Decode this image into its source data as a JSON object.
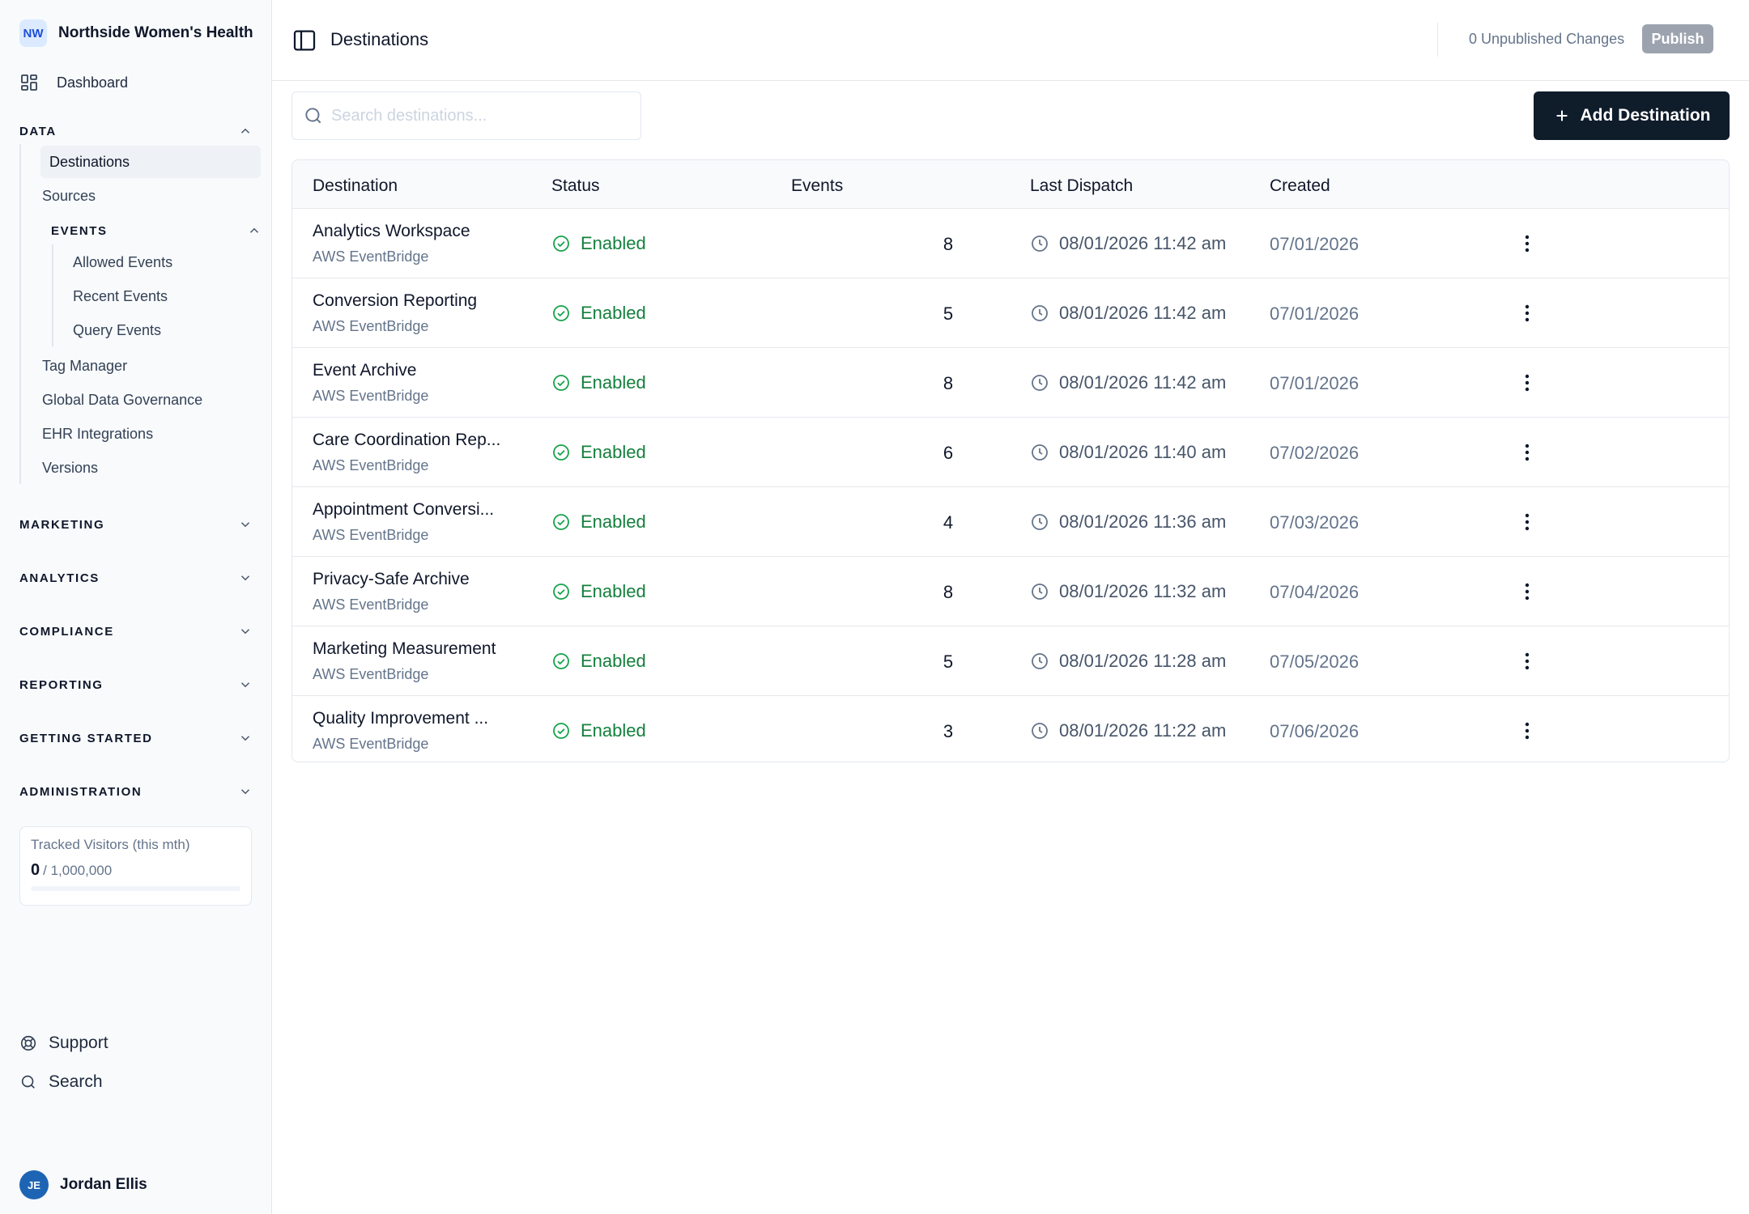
{
  "org": {
    "initials": "NW",
    "name": "Northside Women's Health"
  },
  "nav": {
    "dashboard": "Dashboard",
    "data_section": "DATA",
    "data_items": {
      "destinations": "Destinations",
      "sources": "Sources",
      "events_section": "EVENTS",
      "allowed_events": "Allowed Events",
      "recent_events": "Recent Events",
      "query_events": "Query Events",
      "tag_manager": "Tag Manager",
      "global_data_governance": "Global Data Governance",
      "ehr_integrations": "EHR Integrations",
      "versions": "Versions"
    },
    "sections": [
      "MARKETING",
      "ANALYTICS",
      "COMPLIANCE",
      "REPORTING",
      "GETTING STARTED",
      "ADMINISTRATION"
    ]
  },
  "visitors": {
    "label": "Tracked Visitors (this mth)",
    "count": "0",
    "limit": "/ 1,000,000",
    "progress_fraction": 0
  },
  "bottom": {
    "support": "Support",
    "search": "Search"
  },
  "user": {
    "initials": "JE",
    "name": "Jordan Ellis"
  },
  "header": {
    "title": "Destinations",
    "unpublished": "0 Unpublished Changes",
    "publish": "Publish"
  },
  "toolbar": {
    "search_placeholder": "Search destinations...",
    "add_label": "Add Destination"
  },
  "table": {
    "headers": [
      "Destination",
      "Status",
      "Events",
      "Last Dispatch",
      "Created"
    ],
    "rows": [
      {
        "name": "Analytics Workspace",
        "type": "AWS EventBridge",
        "status": "Enabled",
        "events": "8",
        "last_dispatch": "08/01/2026 11:42 am",
        "created": "07/01/2026"
      },
      {
        "name": "Conversion Reporting",
        "type": "AWS EventBridge",
        "status": "Enabled",
        "events": "5",
        "last_dispatch": "08/01/2026 11:42 am",
        "created": "07/01/2026"
      },
      {
        "name": "Event Archive",
        "type": "AWS EventBridge",
        "status": "Enabled",
        "events": "8",
        "last_dispatch": "08/01/2026 11:42 am",
        "created": "07/01/2026"
      },
      {
        "name": "Care Coordination Rep...",
        "type": "AWS EventBridge",
        "status": "Enabled",
        "events": "6",
        "last_dispatch": "08/01/2026 11:40 am",
        "created": "07/02/2026"
      },
      {
        "name": "Appointment Conversi...",
        "type": "AWS EventBridge",
        "status": "Enabled",
        "events": "4",
        "last_dispatch": "08/01/2026 11:36 am",
        "created": "07/03/2026"
      },
      {
        "name": "Privacy-Safe Archive",
        "type": "AWS EventBridge",
        "status": "Enabled",
        "events": "8",
        "last_dispatch": "08/01/2026 11:32 am",
        "created": "07/04/2026"
      },
      {
        "name": "Marketing Measurement",
        "type": "AWS EventBridge",
        "status": "Enabled",
        "events": "5",
        "last_dispatch": "08/01/2026 11:28 am",
        "created": "07/05/2026"
      },
      {
        "name": "Quality Improvement ...",
        "type": "AWS EventBridge",
        "status": "Enabled",
        "events": "3",
        "last_dispatch": "08/01/2026 11:22 am",
        "created": "07/06/2026"
      }
    ]
  },
  "colors": {
    "primary_button": "#0f1c2a",
    "status_enabled": "#15803d",
    "publish_disabled": "#9ca3af",
    "avatar": "#1e64b4"
  }
}
